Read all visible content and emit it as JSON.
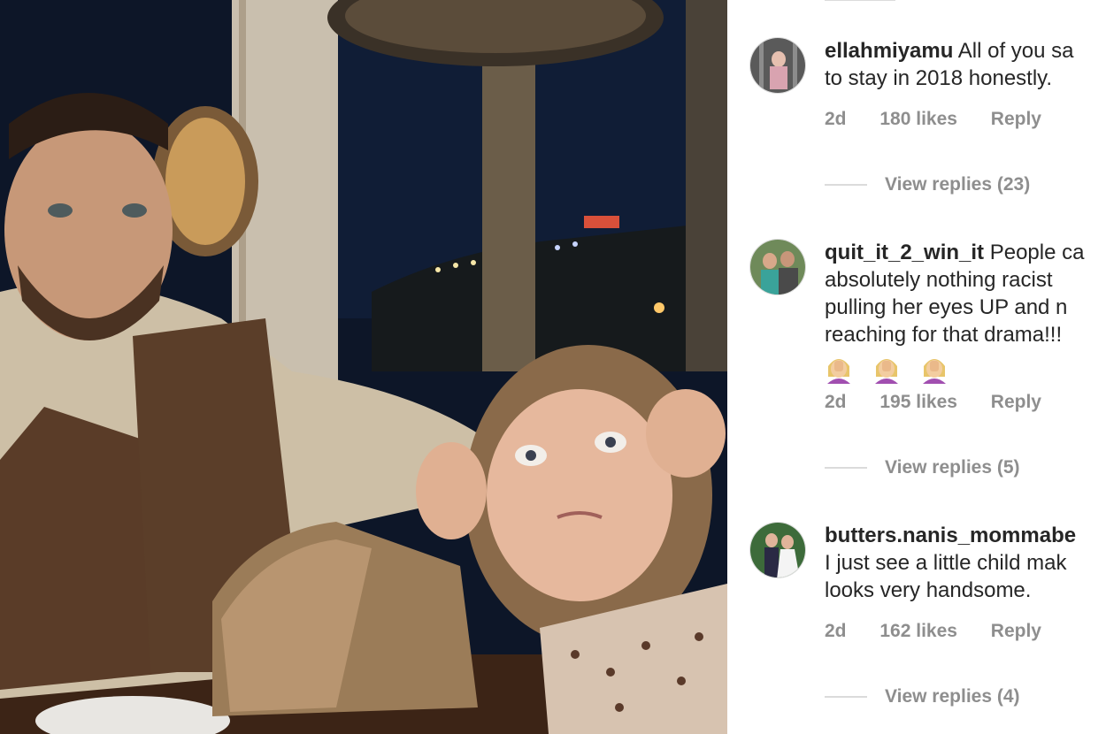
{
  "comments": [
    {
      "username": "ellahmiyamu",
      "lines": [
        "All of you sa",
        "to stay in 2018 honestly."
      ],
      "time": "2d",
      "likes": "180 likes",
      "reply": "Reply",
      "view_replies": "View replies (23)"
    },
    {
      "username": "quit_it_2_win_it",
      "lines": [
        "People ca",
        "absolutely nothing racist",
        "pulling her eyes UP and n",
        "reaching for that drama!!!"
      ],
      "emoji_count": 3,
      "time": "2d",
      "likes": "195 likes",
      "reply": "Reply",
      "view_replies": "View replies (5)"
    },
    {
      "username": "butters.nanis_mommabe",
      "lines": [
        "",
        "I just see a little child mak",
        "looks very handsome."
      ],
      "time": "2d",
      "likes": "162 likes",
      "reply": "Reply",
      "view_replies": "View replies (4)"
    }
  ],
  "colors": {
    "text": "#262626",
    "meta": "#8e8e8e",
    "divider": "#dbdbdb"
  }
}
